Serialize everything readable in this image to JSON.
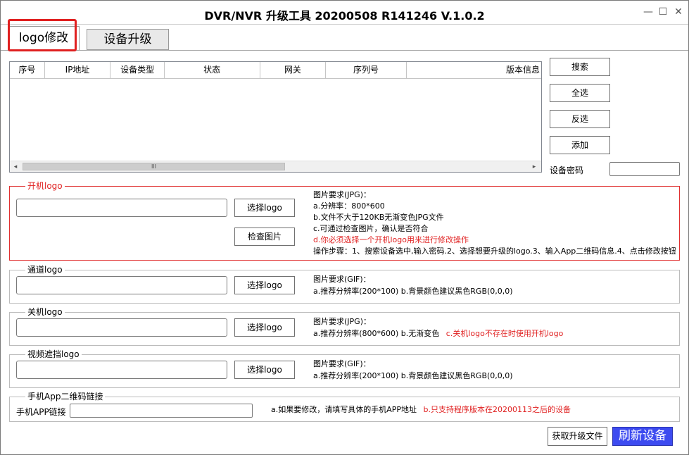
{
  "window": {
    "title": "DVR/NVR 升级工具 20200508 R141246 V.1.0.2",
    "minimize": "—",
    "maximize": "☐",
    "close": "✕"
  },
  "tabs": [
    {
      "label": "logo修改",
      "active": true
    },
    {
      "label": "设备升级",
      "active": false
    }
  ],
  "device_table": {
    "columns": [
      "序号",
      "IP地址",
      "设备类型",
      "状态",
      "网关",
      "序列号",
      "版本信息"
    ],
    "rows": [],
    "scroll_left": "◂",
    "scroll_right": "▸",
    "scroll_grip": "III"
  },
  "actions": {
    "search": "搜索",
    "select_all": "全选",
    "invert": "反选",
    "add": "添加",
    "password_label": "设备密码",
    "password_value": ""
  },
  "boot_logo": {
    "title": "开机logo",
    "path_value": "",
    "select_button": "选择logo",
    "check_button": "检查图片",
    "requirements": [
      {
        "text": "图片要求(JPG)：",
        "highlight": false
      },
      {
        "text": "a.分辨率：800*600",
        "highlight": false
      },
      {
        "text": "b.文件不大于120KB无渐变色JPG文件",
        "highlight": false
      },
      {
        "text": "c.可通过检查图片，确认是否符合",
        "highlight": false
      },
      {
        "text": "d.你必须选择一个开机logo用来进行修改操作",
        "highlight": true
      },
      {
        "text": "操作步骤：1、搜索设备选中,输入密码.2、选择想要升级的logo.3、输入App二维码信息.4、点击修改按钮",
        "highlight": false
      }
    ]
  },
  "channel_logo": {
    "title": "通道logo",
    "path_value": "",
    "select_button": "选择logo",
    "req_title": "图片要求(GIF)：",
    "req_line": "a.推荐分辨率(200*100)  b.背景颜色建议黑色RGB(0,0,0)"
  },
  "shutdown_logo": {
    "title": "关机logo",
    "path_value": "",
    "select_button": "选择logo",
    "req_title": "图片要求(JPG)：",
    "req_line": "a.推荐分辨率(800*600)  b.无渐变色",
    "req_note": "c.关机logo不存在时使用开机logo"
  },
  "video_block_logo": {
    "title": "视频遮挡logo",
    "path_value": "",
    "select_button": "选择logo",
    "req_title": "图片要求(GIF)：",
    "req_line": "a.推荐分辨率(200*100)  b.背景颜色建议黑色RGB(0,0,0)"
  },
  "app_qr": {
    "title": "手机App二维码链接",
    "field_label": "手机APP链接",
    "field_value": "",
    "hint": "a.如果要修改，请填写具体的手机APP地址",
    "hint_note": "b.只支持程序版本在20200113之后的设备"
  },
  "footer": {
    "get_upgrade_file": "获取升级文件",
    "refresh_device": "刷新设备"
  },
  "colors": {
    "accent_red": "#e02020",
    "primary_button": "#3d4bf0"
  }
}
